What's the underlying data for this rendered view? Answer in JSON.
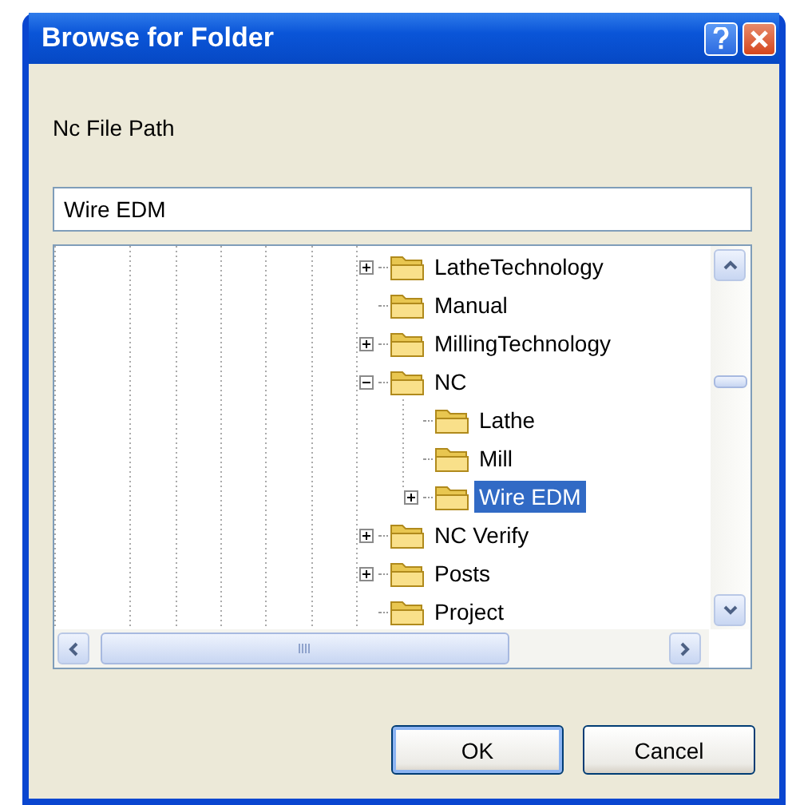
{
  "window": {
    "title": "Browse for Folder"
  },
  "prompt": "Nc File Path",
  "folder_field": {
    "value": "Wire EDM"
  },
  "tree": {
    "items": [
      {
        "label": "LatheTechnology",
        "has_children": true,
        "expanded": false,
        "selected": false
      },
      {
        "label": "Manual",
        "has_children": false,
        "selected": false
      },
      {
        "label": "MillingTechnology",
        "has_children": true,
        "expanded": false,
        "selected": false
      },
      {
        "label": "NC",
        "has_children": true,
        "expanded": true,
        "selected": false,
        "children": [
          {
            "label": "Lathe",
            "has_children": false,
            "selected": false
          },
          {
            "label": "Mill",
            "has_children": false,
            "selected": false
          },
          {
            "label": "Wire EDM",
            "has_children": true,
            "expanded": false,
            "selected": true
          }
        ]
      },
      {
        "label": "NC Verify",
        "has_children": true,
        "expanded": false,
        "selected": false
      },
      {
        "label": "Posts",
        "has_children": true,
        "expanded": false,
        "selected": false
      },
      {
        "label": "Project",
        "has_children": false,
        "selected": false
      }
    ]
  },
  "buttons": [
    {
      "label": "OK",
      "default": true
    },
    {
      "label": "Cancel",
      "default": false
    }
  ]
}
